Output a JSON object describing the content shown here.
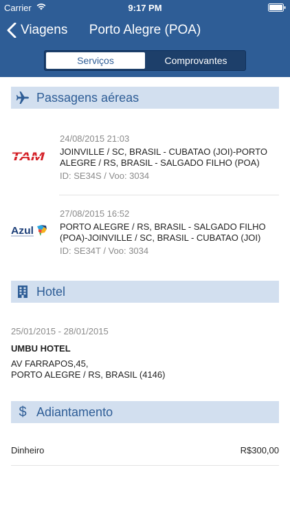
{
  "status": {
    "carrier": "Carrier",
    "time": "9:17 PM"
  },
  "nav": {
    "back_label": "Viagens",
    "title": "Porto Alegre (POA)"
  },
  "tabs": [
    {
      "label": "Serviços",
      "active": true
    },
    {
      "label": "Comprovantes",
      "active": false
    }
  ],
  "flights_section": {
    "title": "Passagens aéreas",
    "items": [
      {
        "airline": "TAM",
        "date": "24/08/2015 21:03",
        "route": "JOINVILLE / SC, BRASIL - CUBATAO (JOI)-PORTO ALEGRE / RS, BRASIL - SALGADO FILHO (POA)",
        "id": "ID: SE34S / Voo: 3034"
      },
      {
        "airline": "Azul",
        "date": "27/08/2015 16:52",
        "route": "PORTO ALEGRE / RS, BRASIL - SALGADO FILHO (POA)-JOINVILLE / SC, BRASIL - CUBATAO (JOI)",
        "id": "ID: SE34T / Voo: 3034"
      }
    ]
  },
  "hotel_section": {
    "title": "Hotel",
    "dates": "25/01/2015 - 28/01/2015",
    "name": "UMBU HOTEL",
    "address_line1": "AV FARRAPOS,45,",
    "address_line2": "PORTO ALEGRE / RS, BRASIL (4146)"
  },
  "advance_section": {
    "title": "Adiantamento",
    "label": "Dinheiro",
    "value": "R$300,00"
  },
  "colors": {
    "header": "#2e5d96",
    "section_bg": "#d2dfef",
    "accent": "#2e5d96"
  }
}
